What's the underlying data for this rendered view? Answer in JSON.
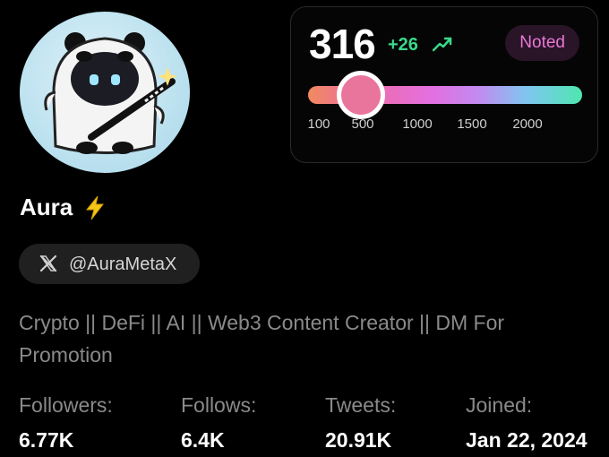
{
  "profile": {
    "display_name": "Aura",
    "name_emoji_icon": "lightning-bolt-icon",
    "handle": "@AuraMetaX",
    "handle_icon": "x-logo-icon",
    "avatar_icon": "panda-ninja-avatar",
    "bio": "Crypto || DeFi || AI || Web3 Content Creator || DM For Promotion"
  },
  "score_card": {
    "score": "316",
    "delta": "+26",
    "delta_icon": "trending-up-icon",
    "badge": "Noted",
    "slider": {
      "ticks": [
        "100",
        "500",
        "1000",
        "1500",
        "2000"
      ],
      "value": 316
    },
    "colors": {
      "delta": "#39d98a",
      "badge_text": "#e879d6",
      "badge_bg": "#2a1428",
      "thumb": "#e9749c"
    }
  },
  "stats": [
    {
      "label": "Followers:",
      "value": "6.77K"
    },
    {
      "label": "Follows:",
      "value": "6.4K"
    },
    {
      "label": "Tweets:",
      "value": "20.91K"
    },
    {
      "label": "Joined:",
      "value": "Jan 22, 2024"
    }
  ]
}
